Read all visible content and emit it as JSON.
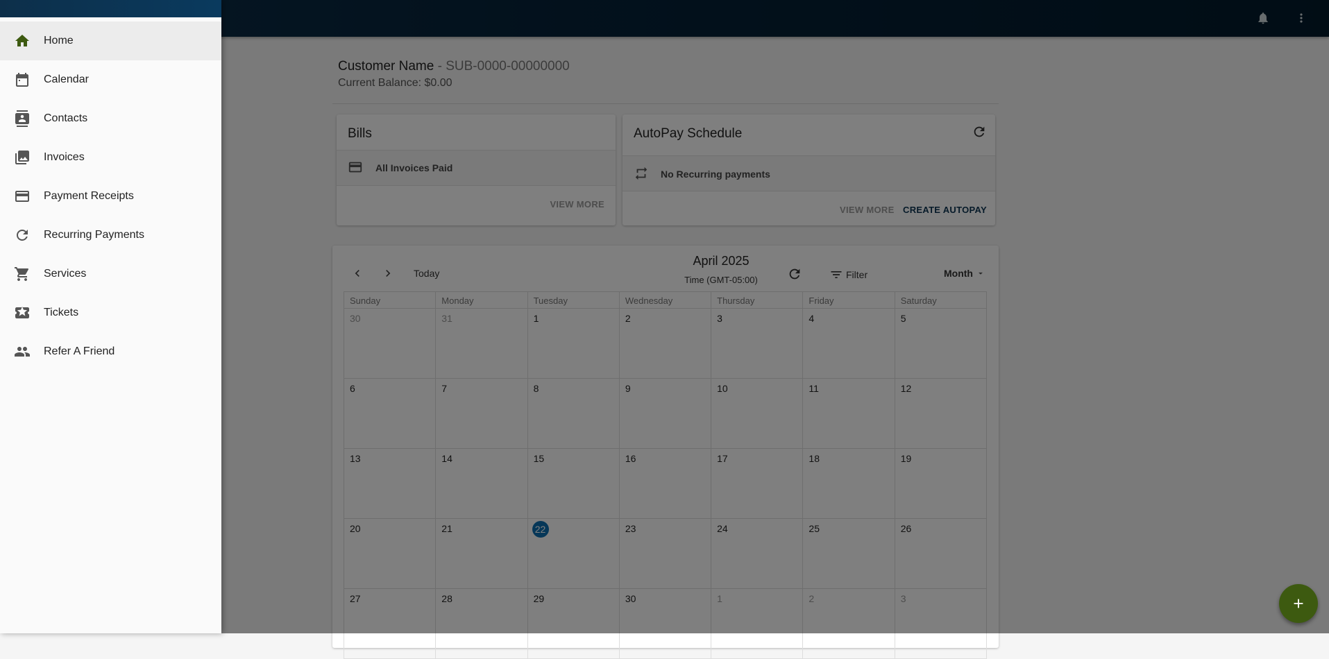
{
  "colors": {
    "topbar": "#021a2b",
    "primary": "#0d3552",
    "today_highlight": "#0c6fb0",
    "fab": "#3d5a10",
    "home_icon": "#3d5a10"
  },
  "topbar": {
    "icons": [
      "bell-icon",
      "more-vert-icon"
    ]
  },
  "customer": {
    "name": "Customer Name",
    "sub_id": " - SUB-0000-00000000",
    "balance": "Current Balance: $0.00"
  },
  "bills": {
    "title": "Bills",
    "status": "All Invoices Paid",
    "view_more": "VIEW MORE",
    "icon": "credit-card-icon"
  },
  "autopay": {
    "title": "AutoPay Schedule",
    "status": "No Recurring payments",
    "view_more": "VIEW MORE",
    "create": "CREATE AUTOPAY",
    "icon": "repeat-icon"
  },
  "calendar": {
    "today_label": "Today",
    "month_label": "April 2025",
    "timezone": "Time (GMT-05:00)",
    "filter_label": "Filter",
    "view_label": "Month",
    "weekdays": [
      "Sunday",
      "Monday",
      "Tuesday",
      "Wednesday",
      "Thursday",
      "Friday",
      "Saturday"
    ],
    "days": [
      {
        "n": "30",
        "other": true
      },
      {
        "n": "31",
        "other": true
      },
      {
        "n": "1"
      },
      {
        "n": "2"
      },
      {
        "n": "3"
      },
      {
        "n": "4"
      },
      {
        "n": "5"
      },
      {
        "n": "6"
      },
      {
        "n": "7"
      },
      {
        "n": "8"
      },
      {
        "n": "9"
      },
      {
        "n": "10"
      },
      {
        "n": "11"
      },
      {
        "n": "12"
      },
      {
        "n": "13"
      },
      {
        "n": "14"
      },
      {
        "n": "15"
      },
      {
        "n": "16"
      },
      {
        "n": "17"
      },
      {
        "n": "18"
      },
      {
        "n": "19"
      },
      {
        "n": "20"
      },
      {
        "n": "21"
      },
      {
        "n": "22",
        "today": true
      },
      {
        "n": "23"
      },
      {
        "n": "24"
      },
      {
        "n": "25"
      },
      {
        "n": "26"
      },
      {
        "n": "27"
      },
      {
        "n": "28"
      },
      {
        "n": "29"
      },
      {
        "n": "30"
      },
      {
        "n": "1",
        "other": true
      },
      {
        "n": "2",
        "other": true
      },
      {
        "n": "3",
        "other": true
      }
    ]
  },
  "sidebar": {
    "items": [
      {
        "label": "Home",
        "icon": "home-icon",
        "active": true
      },
      {
        "label": "Calendar",
        "icon": "calendar-icon"
      },
      {
        "label": "Contacts",
        "icon": "contacts-icon"
      },
      {
        "label": "Invoices",
        "icon": "invoices-icon"
      },
      {
        "label": "Payment Receipts",
        "icon": "credit-card-icon"
      },
      {
        "label": "Recurring Payments",
        "icon": "refresh-icon"
      },
      {
        "label": "Services",
        "icon": "cart-icon"
      },
      {
        "label": "Tickets",
        "icon": "ticket-icon"
      },
      {
        "label": "Refer A Friend",
        "icon": "people-icon"
      }
    ]
  },
  "fab": {
    "icon": "plus-icon"
  }
}
